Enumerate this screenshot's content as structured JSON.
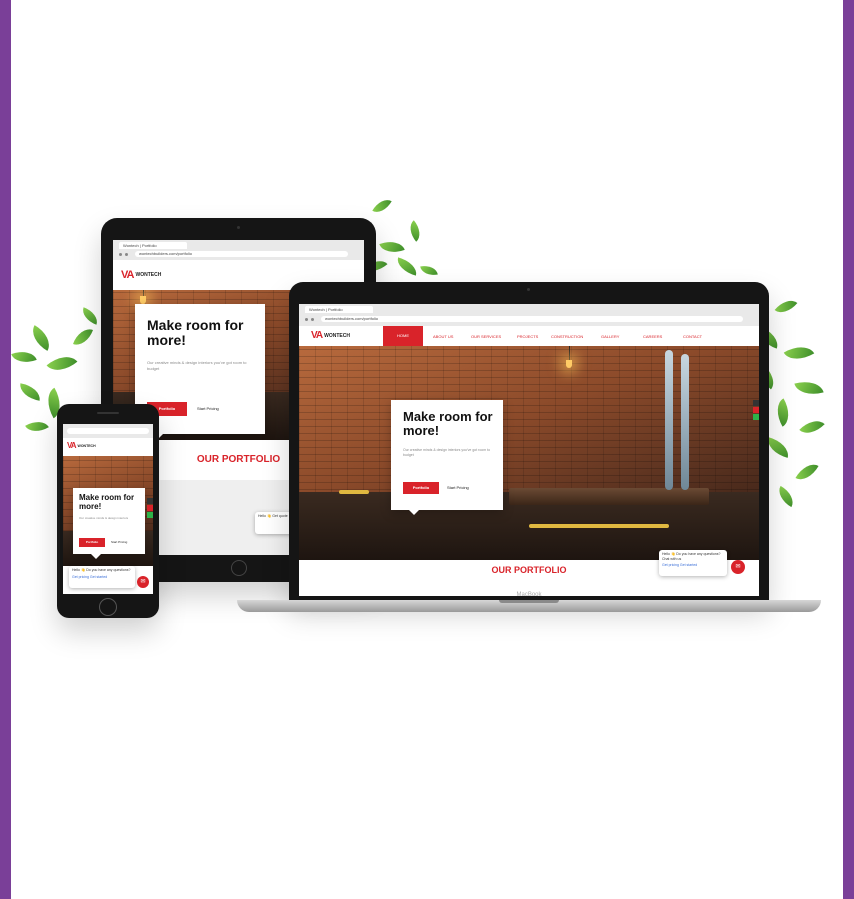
{
  "brand_logo": {
    "mark": "VA",
    "word": "WONTECH"
  },
  "tablet": {
    "tab_title": "Wontech | Portfolio",
    "url": "wontechbuilders.com/portfolio",
    "hero_heading": "Make room for more!",
    "hero_text": "Our creative minds & design interiors you've got room to budget",
    "primary_button": "Portfolio",
    "secondary_button": "Start Pricing",
    "section_title": "OUR PORTFOLIO",
    "chat_text": "Hello 👋 Get quote"
  },
  "laptop": {
    "tab_title": "Wontech | Portfolio",
    "url": "wontechbuilders.com/portfolio",
    "nav": [
      "HOME",
      "ABOUT US",
      "OUR SERVICES",
      "PROJECTS",
      "CONSTRUCTION",
      "GALLERY",
      "CAREERS",
      "CONTACT"
    ],
    "hero_heading": "Make room for more!",
    "hero_text": "Our creative minds & design interiors you've got room to budget",
    "primary_button": "Portfolio",
    "secondary_button": "Start Pricing",
    "section_title": "OUR PORTFOLIO",
    "chat_text": "Hello 👋 Do you have any questions? Chat with us",
    "chat_links": "Get pricing   Get started",
    "base_label": "MacBook"
  },
  "phone": {
    "hero_heading": "Make room for more!",
    "hero_text": "Our creative minds & design interiors",
    "primary_button": "Portfolio",
    "secondary_button": "Start Pricing",
    "chat_text": "Hello 👋 Do you have any questions?",
    "chat_links": "Get pricing   Get started"
  },
  "colors": {
    "frame": "#7a3f98",
    "accent": "#d9232a"
  }
}
